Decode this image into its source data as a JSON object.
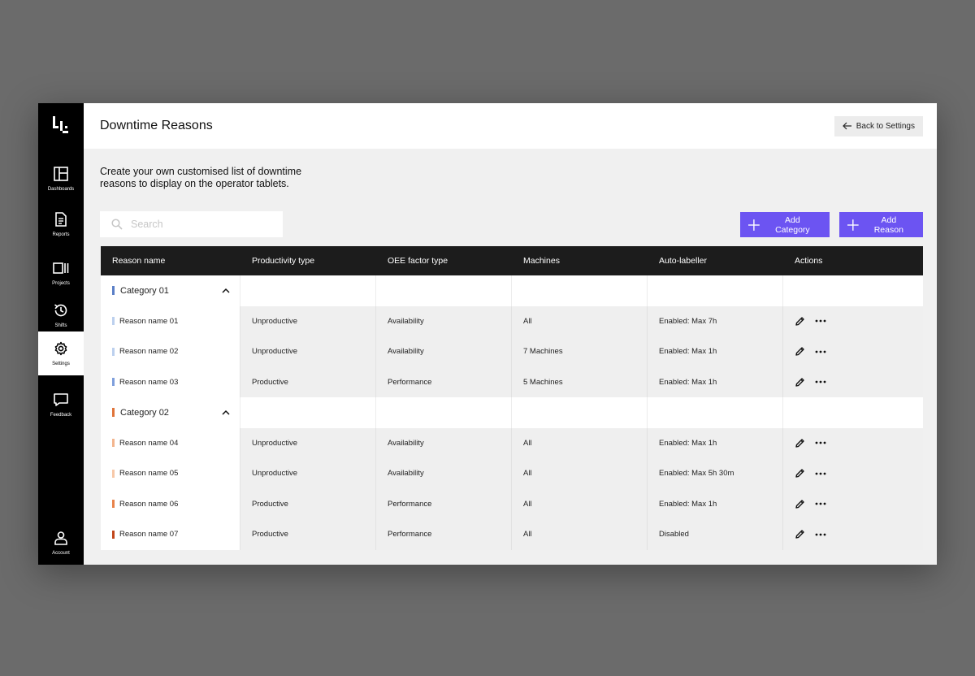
{
  "sidebar": {
    "items": [
      {
        "label": "Dashboards",
        "icon": "dashboard-icon"
      },
      {
        "label": "Reports",
        "icon": "report-icon"
      },
      {
        "label": "Projects",
        "icon": "projects-icon"
      },
      {
        "label": "Shifts",
        "icon": "history-icon"
      },
      {
        "label": "Settings",
        "icon": "gear-icon",
        "active": true
      },
      {
        "label": "Feedback",
        "icon": "chat-icon"
      },
      {
        "label": "Account",
        "icon": "user-icon"
      }
    ]
  },
  "header": {
    "title": "Downtime Reasons",
    "back_label": "Back to Settings"
  },
  "description": "Create your own customised list of downtime reasons to display on the operator tablets.",
  "search": {
    "placeholder": "Search",
    "value": ""
  },
  "buttons": {
    "add_category": "Add Category",
    "add_reason": "Add Reason"
  },
  "colors": {
    "accent": "#6c54f2",
    "category_01": "#5b7fc7",
    "category_02": "#e0743a"
  },
  "table": {
    "columns": [
      "Reason name",
      "Productivity type",
      "OEE factor type",
      "Machines",
      "Auto-labeller",
      "Actions"
    ],
    "categories": [
      {
        "name": "Category 01",
        "color": "#5b7fc7",
        "reasons": [
          {
            "name": "Reason name 01",
            "color": "#bcd0ee",
            "productivity": "Unproductive",
            "oee": "Availability",
            "machines": "All",
            "auto": "Enabled: Max 7h"
          },
          {
            "name": "Reason name 02",
            "color": "#bcd0ee",
            "productivity": "Unproductive",
            "oee": "Availability",
            "machines": "7 Machines",
            "auto": "Enabled: Max 1h"
          },
          {
            "name": "Reason name 03",
            "color": "#7f9fdc",
            "productivity": "Productive",
            "oee": "Performance",
            "machines": "5 Machines",
            "auto": "Enabled: Max 1h"
          }
        ]
      },
      {
        "name": "Category 02",
        "color": "#e0743a",
        "reasons": [
          {
            "name": "Reason name 04",
            "color": "#f3b58e",
            "productivity": "Unproductive",
            "oee": "Availability",
            "machines": "All",
            "auto": "Enabled: Max 1h"
          },
          {
            "name": "Reason name 05",
            "color": "#f7c8a8",
            "productivity": "Unproductive",
            "oee": "Availability",
            "machines": "All",
            "auto": "Enabled: Max 5h 30m"
          },
          {
            "name": "Reason name 06",
            "color": "#e8834a",
            "productivity": "Productive",
            "oee": "Performance",
            "machines": "All",
            "auto": "Enabled: Max 1h"
          },
          {
            "name": "Reason name 07",
            "color": "#c2461a",
            "productivity": "Productive",
            "oee": "Performance",
            "machines": "All",
            "auto": "Disabled"
          }
        ]
      }
    ]
  }
}
